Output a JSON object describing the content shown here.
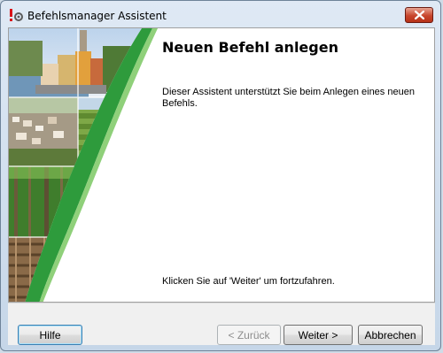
{
  "window": {
    "title": "Befehlsmanager Assistent"
  },
  "page": {
    "title": "Neuen Befehl anlegen",
    "description": "Dieser Assistent unterstützt Sie beim Anlegen eines neuen Befehls.",
    "hint": "Klicken Sie auf 'Weiter' um fortzufahren."
  },
  "buttons": {
    "help": "Hilfe",
    "back": "< Zurück",
    "next": "Weiter >",
    "cancel": "Abbrechen"
  },
  "icons": {
    "app": "exclamation-gear-icon",
    "close": "close-icon"
  },
  "colors": {
    "accent_green": "#2e9b3c",
    "close_red": "#c8462d"
  }
}
